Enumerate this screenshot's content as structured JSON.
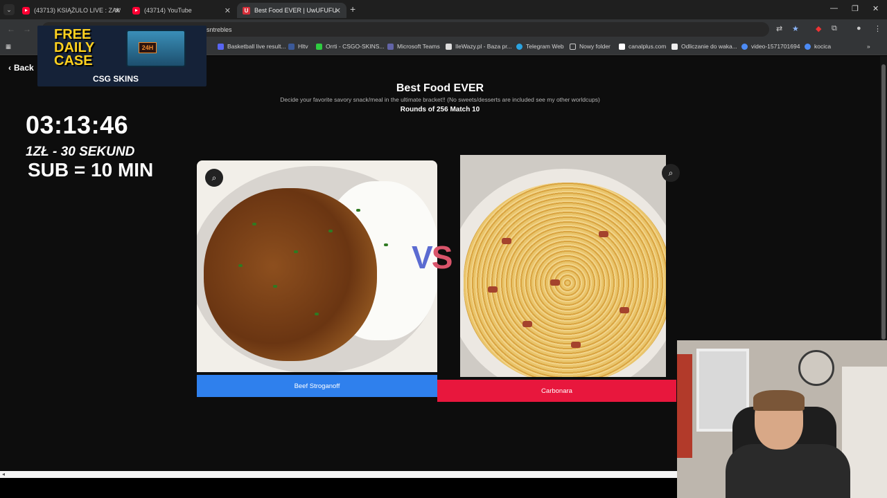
{
  "browser": {
    "tabs": [
      {
        "title": "(43713) KSIĄŻULO LIVE : ZAMY",
        "icon": "youtube-icon"
      },
      {
        "title": "(43714) YouTube",
        "icon": "youtube-icon"
      },
      {
        "title": "Best Food EVER | UwUFUFU",
        "icon": "uwufufu-icon",
        "active": true
      }
    ],
    "address_fragment": "isntrebles",
    "bookmarks": [
      "Basketball live result...",
      "Hltv",
      "Orrti - CSGO-SKINS...",
      "Microsoft Teams",
      "IleWazy.pl - Baza pr...",
      "Telegram Web",
      "Nowy folder",
      "canalplus.com",
      "Odliczanie do waka...",
      "video-1571701694",
      "kocica"
    ]
  },
  "sponsor": {
    "line1": "FREE",
    "line2": "DAILY",
    "line3": "CASE",
    "badge": "24H",
    "brand": "CSG SKINS"
  },
  "page": {
    "back_label": "Back",
    "title": "Best Food EVER",
    "subtitle": "Decide your favorite savory snack/meal in the ultimate bracket!! (No sweets/desserts are included see my other worldcups)",
    "round_info": "Rounds of 256 Match 10",
    "vs_left": "V",
    "vs_right": "S",
    "left_choice": "Beef Stroganoff",
    "right_choice": "Carbonara"
  },
  "stream_overlay": {
    "timer": "03:13:46",
    "donation_rate": "1ZŁ - 30 SEKUND",
    "sub_rate": "SUB = 10 MIN"
  },
  "colors": {
    "left_button": "#2f80ed",
    "right_button": "#e8173d",
    "sponsor_yellow": "#ffd21f"
  }
}
